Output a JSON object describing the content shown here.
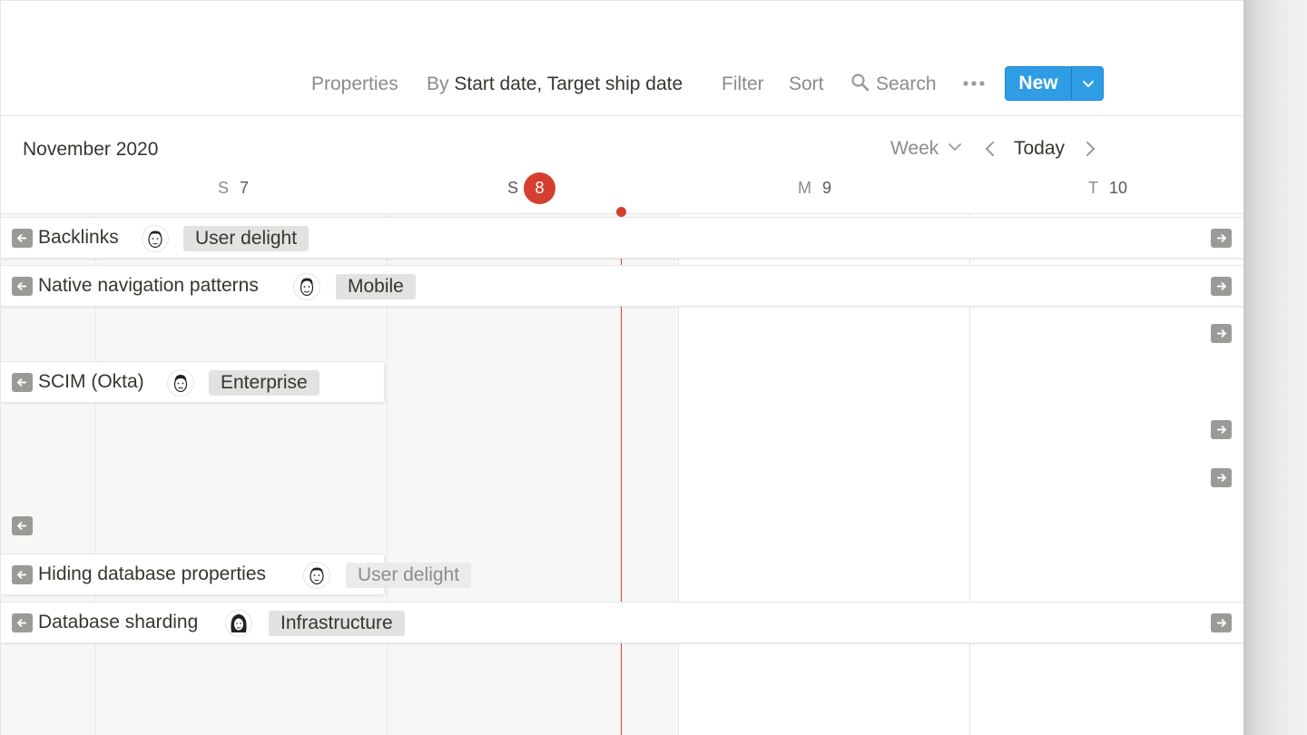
{
  "toolbar": {
    "properties_label": "Properties",
    "group_by_prefix": "By",
    "group_by_value": "Start date, Target ship date",
    "filter_label": "Filter",
    "sort_label": "Sort",
    "search_label": "Search",
    "more_icon": "more-horizontal-icon",
    "new_label": "New",
    "new_color": "#2f9de6"
  },
  "calendar": {
    "month_title": "November 2020",
    "view_label": "Week",
    "today_label": "Today",
    "days": [
      {
        "letter": "S",
        "number": "7"
      },
      {
        "letter": "S",
        "number": "8",
        "is_today": true
      },
      {
        "letter": "M",
        "number": "9"
      },
      {
        "letter": "T",
        "number": "10"
      }
    ],
    "today_color": "#d43f2f"
  },
  "items": [
    {
      "title": "Backlinks",
      "tag": "User delight",
      "avatar": "person-avatar-icon"
    },
    {
      "title": "Native navigation patterns",
      "tag": "Mobile",
      "avatar": "person-avatar-icon"
    },
    {
      "title": "SCIM (Okta)",
      "tag": "Enterprise",
      "avatar": "person-avatar-icon"
    },
    {
      "title": "Hiding database properties",
      "tag": "User delight",
      "avatar": "person-avatar-icon"
    },
    {
      "title": "Database sharding",
      "tag": "Infrastructure",
      "avatar": "person-avatar-icon"
    }
  ]
}
